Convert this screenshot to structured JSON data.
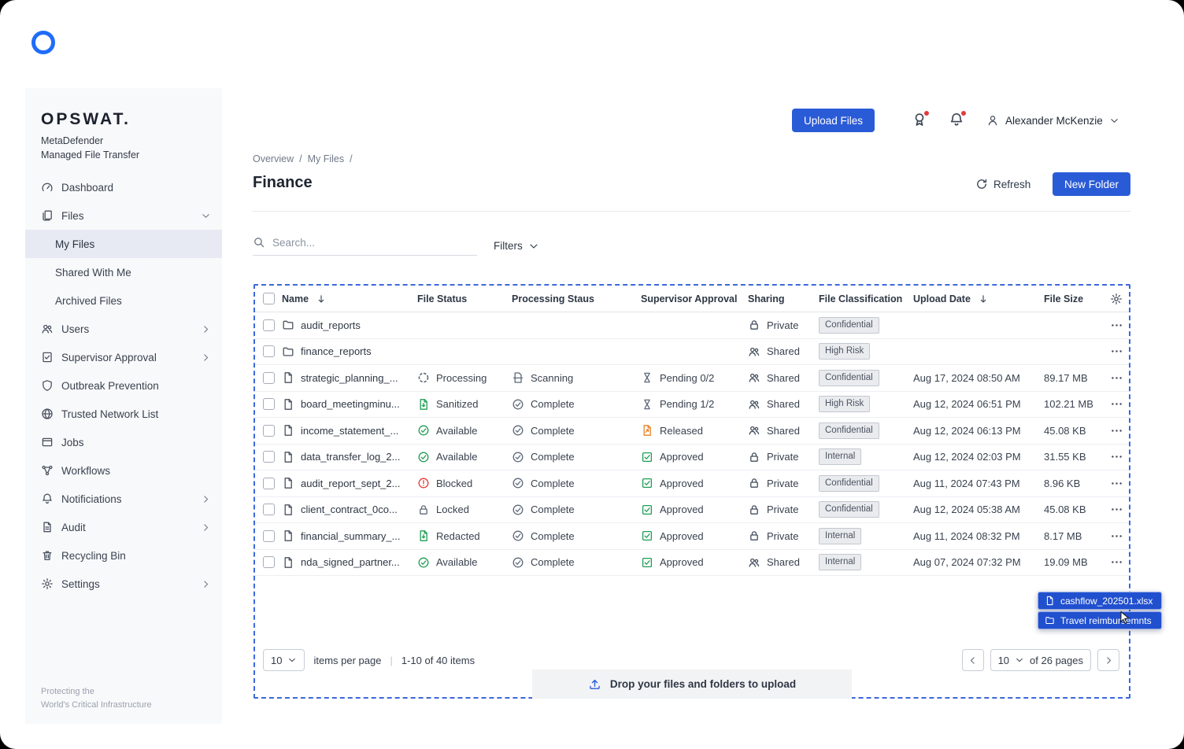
{
  "brand": {
    "name": "OPSWAT.",
    "product": "MetaDefender",
    "suite": "Managed File Transfer",
    "tagline_1": "Protecting the",
    "tagline_2": "World's Critical Infrastructure"
  },
  "sidebar": {
    "items": [
      {
        "label": "Dashboard",
        "icon": "dashboard-icon"
      },
      {
        "label": "Files",
        "icon": "files-icon",
        "chevron": "down"
      },
      {
        "label": "My Files",
        "indent": true,
        "active": true
      },
      {
        "label": "Shared With Me",
        "indent": true
      },
      {
        "label": "Archived Files",
        "indent": true
      },
      {
        "label": "Users",
        "icon": "users-icon",
        "chevron": "right"
      },
      {
        "label": "Supervisor Approval",
        "icon": "approval-icon",
        "chevron": "right"
      },
      {
        "label": "Outbreak Prevention",
        "icon": "shield-icon"
      },
      {
        "label": "Trusted Network List",
        "icon": "globe-icon"
      },
      {
        "label": "Jobs",
        "icon": "jobs-icon"
      },
      {
        "label": "Workflows",
        "icon": "workflow-icon"
      },
      {
        "label": "Notificiations",
        "icon": "bell-icon",
        "chevron": "right"
      },
      {
        "label": "Audit",
        "icon": "audit-icon",
        "chevron": "right"
      },
      {
        "label": "Recycling Bin",
        "icon": "recycle-icon"
      },
      {
        "label": "Settings",
        "icon": "gear-icon",
        "chevron": "right"
      }
    ]
  },
  "header": {
    "upload_button": "Upload Files",
    "user_name": "Alexander McKenzie"
  },
  "breadcrumb": {
    "items": [
      "Overview",
      "My Files"
    ],
    "separator": "/"
  },
  "page": {
    "title": "Finance",
    "refresh": "Refresh",
    "new_folder": "New Folder"
  },
  "toolbar": {
    "search_placeholder": "Search...",
    "filters": "Filters"
  },
  "table": {
    "headers": {
      "name": "Name",
      "file_status": "File Status",
      "processing_status": "Processing Staus",
      "supervisor_approval": "Supervisor Approval",
      "sharing": "Sharing",
      "file_classification": "File Classification",
      "upload_date": "Upload Date",
      "file_size": "File Size"
    },
    "rows": [
      {
        "name": "audit_reports",
        "icon": "folder-icon",
        "status": "",
        "status_icon": "",
        "status_tone": "",
        "proc": "",
        "proc_icon": "",
        "proc_tone": "",
        "appr": "",
        "appr_icon": "",
        "appr_tone": "",
        "share": "Private",
        "share_icon": "lock-icon",
        "cls": "Confidential",
        "date": "",
        "size": ""
      },
      {
        "name": "finance_reports",
        "icon": "folder-icon",
        "status": "",
        "status_icon": "",
        "status_tone": "",
        "proc": "",
        "proc_icon": "",
        "proc_tone": "",
        "appr": "",
        "appr_icon": "",
        "appr_tone": "",
        "share": "Shared",
        "share_icon": "people-icon",
        "cls": "High Risk",
        "date": "",
        "size": ""
      },
      {
        "name": "strategic_planning_...",
        "icon": "file-icon",
        "status": "Processing",
        "status_icon": "spinner-icon",
        "status_tone": "gray",
        "proc": "Scanning",
        "proc_icon": "scan-icon",
        "proc_tone": "gray",
        "appr": "Pending 0/2",
        "appr_icon": "hourglass-icon",
        "appr_tone": "gray",
        "share": "Shared",
        "share_icon": "people-icon",
        "cls": "Confidential",
        "date": "Aug 17, 2024 08:50 AM",
        "size": "89.17 MB"
      },
      {
        "name": "board_meetingminu...",
        "icon": "file-icon",
        "status": "Sanitized",
        "status_icon": "doc-clean-icon",
        "status_tone": "green",
        "proc": "Complete",
        "proc_icon": "check-circle-icon",
        "proc_tone": "gray",
        "appr": "Pending 1/2",
        "appr_icon": "hourglass-icon",
        "appr_tone": "gray",
        "share": "Shared",
        "share_icon": "people-icon",
        "cls": "High Risk",
        "date": "Aug 12, 2024 06:51 PM",
        "size": "102.21 MB"
      },
      {
        "name": "income_statement_...",
        "icon": "file-icon",
        "status": "Available",
        "status_icon": "check-circle-icon",
        "status_tone": "green",
        "proc": "Complete",
        "proc_icon": "check-circle-icon",
        "proc_tone": "gray",
        "appr": "Released",
        "appr_icon": "release-icon",
        "appr_tone": "orange",
        "share": "Shared",
        "share_icon": "people-icon",
        "cls": "Confidential",
        "date": "Aug 12, 2024 06:13 PM",
        "size": "45.08 KB"
      },
      {
        "name": "data_transfer_log_2...",
        "icon": "file-icon",
        "status": "Available",
        "status_icon": "check-circle-icon",
        "status_tone": "green",
        "proc": "Complete",
        "proc_icon": "check-circle-icon",
        "proc_tone": "gray",
        "appr": "Approved",
        "appr_icon": "approved-icon",
        "appr_tone": "green",
        "share": "Private",
        "share_icon": "lock-icon",
        "cls": "Internal",
        "date": "Aug 12, 2024 02:03 PM",
        "size": "31.55 KB"
      },
      {
        "name": "audit_report_sept_2...",
        "icon": "file-icon",
        "status": "Blocked",
        "status_icon": "alert-circle-icon",
        "status_tone": "red",
        "proc": "Complete",
        "proc_icon": "check-circle-icon",
        "proc_tone": "gray",
        "appr": "Approved",
        "appr_icon": "approved-icon",
        "appr_tone": "green",
        "share": "Private",
        "share_icon": "lock-icon",
        "cls": "Confidential",
        "date": "Aug 11, 2024 07:43 PM",
        "size": "8.96 KB"
      },
      {
        "name": "client_contract_0co...",
        "icon": "file-icon",
        "status": "Locked",
        "status_icon": "lock-icon",
        "status_tone": "gray",
        "proc": "Complete",
        "proc_icon": "check-circle-icon",
        "proc_tone": "gray",
        "appr": "Approved",
        "appr_icon": "approved-icon",
        "appr_tone": "green",
        "share": "Private",
        "share_icon": "lock-icon",
        "cls": "Confidential",
        "date": "Aug 12, 2024 05:38 AM",
        "size": "45.08 KB"
      },
      {
        "name": "financial_summary_...",
        "icon": "file-icon",
        "status": "Redacted",
        "status_icon": "doc-clean-icon",
        "status_tone": "green",
        "proc": "Complete",
        "proc_icon": "check-circle-icon",
        "proc_tone": "gray",
        "appr": "Approved",
        "appr_icon": "approved-icon",
        "appr_tone": "green",
        "share": "Private",
        "share_icon": "lock-icon",
        "cls": "Internal",
        "date": "Aug 11, 2024 08:32 PM",
        "size": "8.17 MB"
      },
      {
        "name": "nda_signed_partner...",
        "icon": "file-icon",
        "status": "Available",
        "status_icon": "check-circle-icon",
        "status_tone": "green",
        "proc": "Complete",
        "proc_icon": "check-circle-icon",
        "proc_tone": "gray",
        "appr": "Approved",
        "appr_icon": "approved-icon",
        "appr_tone": "green",
        "share": "Shared",
        "share_icon": "people-icon",
        "cls": "Internal",
        "date": "Aug 07, 2024 07:32 PM",
        "size": "19.09 MB"
      }
    ]
  },
  "pagination": {
    "page_size": "10",
    "items_per_page_label": "items per page",
    "separator": "|",
    "range_label": "1-10 of 40 items",
    "page_number": "10",
    "pages_label": "of 26 pages"
  },
  "dropzone": {
    "label": "Drop your files and folders to upload"
  },
  "drag_preview": [
    {
      "label": "cashflow_202501.xlsx",
      "icon": "file-icon"
    },
    {
      "label": "Travel reimbursemnts",
      "icon": "folder-icon"
    }
  ],
  "colors": {
    "primary": "#2a5bd7",
    "green": "#1f9d55",
    "red": "#e23b3b",
    "orange": "#e8832a",
    "dashed_border": "#3c68da"
  }
}
